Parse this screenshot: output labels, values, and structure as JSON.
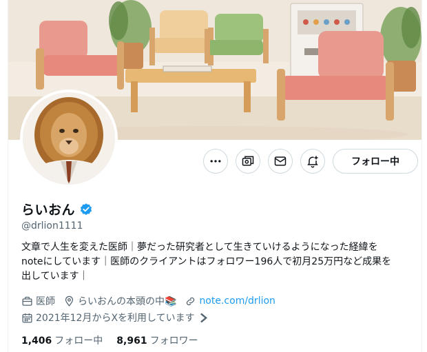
{
  "profile": {
    "display_name": "らいおん",
    "handle": "@drlion1111",
    "bio_lines": [
      "文章で人生を変えた医師｜夢だった研究者として生きていけるようになった経緯を",
      "noteにしています｜医師のクライアントはフォロワー196人で初月25万円など成果を",
      "出しています｜"
    ],
    "occupation": "医師",
    "location": "らいおんの本頭の中📚",
    "website": "note.com/drlion",
    "joined": "2021年12月からXを利用しています",
    "following_count": "1,406",
    "following_label": "フォロー中",
    "followers_count": "8,961",
    "followers_label": "フォロワー"
  },
  "actions": {
    "follow_label": "フォロー中",
    "more_icon": "more-icon",
    "subscribe_icon": "subscribe-icon",
    "message_icon": "mail-icon",
    "notify_icon": "bell-plus-icon"
  },
  "colors": {
    "link": "#1d9bf0",
    "verified": "#1d9bf0",
    "secondary_text": "#536471",
    "border": "#cfd9de"
  }
}
